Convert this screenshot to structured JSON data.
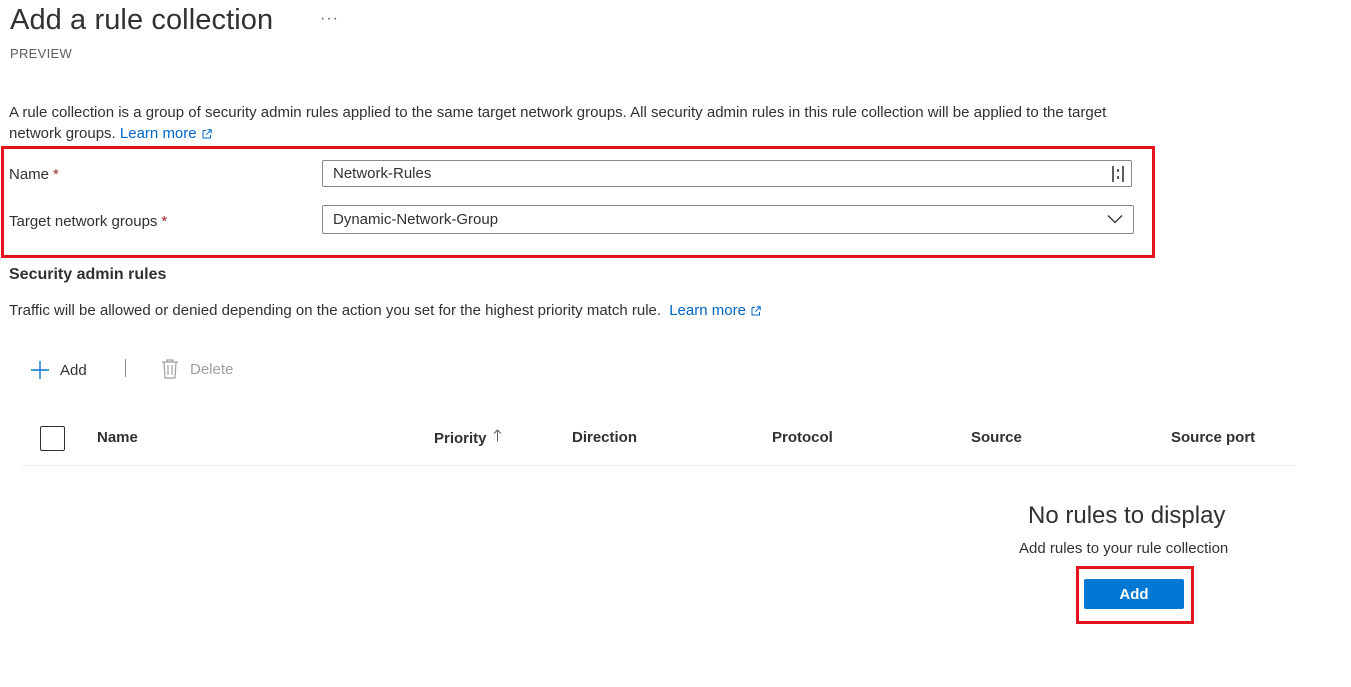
{
  "header": {
    "title": "Add a rule collection",
    "more_label": "···",
    "subtitle": "PREVIEW"
  },
  "description": {
    "text": "A rule collection is a group of security admin rules applied to the same target network groups. All security admin rules in this rule collection will be applied to the target network groups.",
    "learn_more": "Learn more"
  },
  "form": {
    "name_label": "Name",
    "name_value": "Network-Rules",
    "target_label": "Target network groups",
    "target_value": "Dynamic-Network-Group",
    "required_marker": "*"
  },
  "security_rules": {
    "title": "Security admin rules",
    "description": "Traffic will be allowed or denied depending on the action you set for the highest priority match rule.",
    "learn_more": "Learn more"
  },
  "toolbar": {
    "add_label": "Add",
    "delete_label": "Delete"
  },
  "table": {
    "columns": [
      "Name",
      "Priority",
      "Direction",
      "Protocol",
      "Source",
      "Source port"
    ]
  },
  "empty_state": {
    "title": "No rules to display",
    "description": "Add rules to your rule collection",
    "add_button": "Add"
  },
  "icons": {
    "more": "more-icon",
    "external_link": "external-link-icon",
    "input_helper": "input-helper-icon",
    "dropdown": "chevron-down-icon",
    "add": "plus-icon",
    "delete": "trash-icon",
    "sort": "sort-ascending-icon"
  },
  "colors": {
    "link": "#0066c6",
    "primary": "#0078d4",
    "highlight": "#e3141e",
    "required": "#a4262c"
  }
}
